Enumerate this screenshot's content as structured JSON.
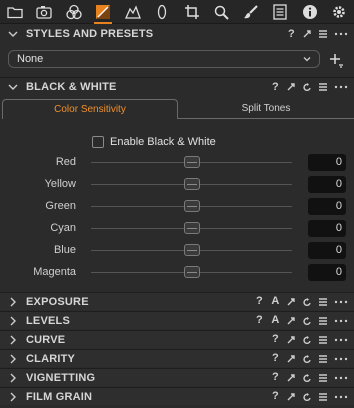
{
  "toolbar": {
    "tools": [
      {
        "name": "folder-icon",
        "active": false
      },
      {
        "name": "camera-icon",
        "active": false
      },
      {
        "name": "color-circles-icon",
        "active": false
      },
      {
        "name": "exposure-icon",
        "active": true
      },
      {
        "name": "lens-icon",
        "active": false
      },
      {
        "name": "oval-icon",
        "active": false
      },
      {
        "name": "crop-icon",
        "active": false
      },
      {
        "name": "magnifier-icon",
        "active": false
      },
      {
        "name": "brush-icon",
        "active": false
      },
      {
        "name": "metadata-icon",
        "active": false
      },
      {
        "name": "info-icon",
        "active": false
      },
      {
        "name": "gear-icon",
        "active": false
      }
    ],
    "accent_color": "#e8821e"
  },
  "styles": {
    "title": "STYLES AND PRESETS",
    "preset_value": "None"
  },
  "bw": {
    "title": "BLACK & WHITE",
    "tabs": [
      "Color Sensitivity",
      "Split Tones"
    ],
    "active_tab": "Color Sensitivity",
    "enable_label": "Enable Black & White",
    "enabled": false,
    "sliders": [
      {
        "label": "Red",
        "value": "0",
        "level": 0.5
      },
      {
        "label": "Yellow",
        "value": "0",
        "level": 0.5
      },
      {
        "label": "Green",
        "value": "0",
        "level": 0.5
      },
      {
        "label": "Cyan",
        "value": "0",
        "level": 0.5
      },
      {
        "label": "Blue",
        "value": "0",
        "level": 0.5
      },
      {
        "label": "Magenta",
        "value": "0",
        "level": 0.5
      }
    ]
  },
  "collapsed_sections": [
    {
      "title": "EXPOSURE",
      "has_auto": true
    },
    {
      "title": "LEVELS",
      "has_auto": true
    },
    {
      "title": "CURVE",
      "has_auto": false
    },
    {
      "title": "CLARITY",
      "has_auto": false
    },
    {
      "title": "VIGNETTING",
      "has_auto": false
    },
    {
      "title": "FILM GRAIN",
      "has_auto": false
    }
  ],
  "header_icons": {
    "help": "?",
    "auto": "A"
  }
}
